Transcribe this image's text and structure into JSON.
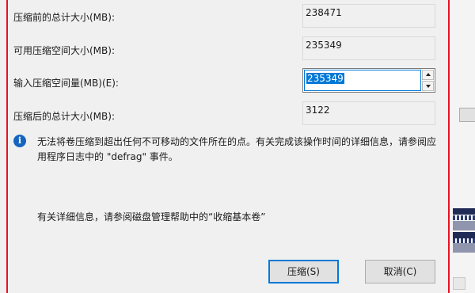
{
  "dialog": {
    "fields": {
      "total_before": {
        "label": "压缩前的总计大小(MB):",
        "value": "238471"
      },
      "available": {
        "label": "可用压缩空间大小(MB):",
        "value": "235349"
      },
      "shrink_amount": {
        "label": "输入压缩空间量(MB)(E):",
        "value": "235349"
      },
      "total_after": {
        "label": "压缩后的总计大小(MB):",
        "value": "3122"
      }
    },
    "info": {
      "icon": "info-icon",
      "text": "无法将卷压缩到超出任何不可移动的文件所在的点。有关完成该操作时间的详细信息，请参阅应用程序日志中的 \"defrag\" 事件。"
    },
    "help_text": "有关详细信息，请参阅磁盘管理帮助中的“收缩基本卷”",
    "buttons": {
      "shrink": "压缩(S)",
      "cancel": "取消(C)"
    }
  },
  "colors": {
    "highlight_border": "#e81123",
    "accent": "#0078d7",
    "dialog_bg": "#f0f0f0"
  }
}
